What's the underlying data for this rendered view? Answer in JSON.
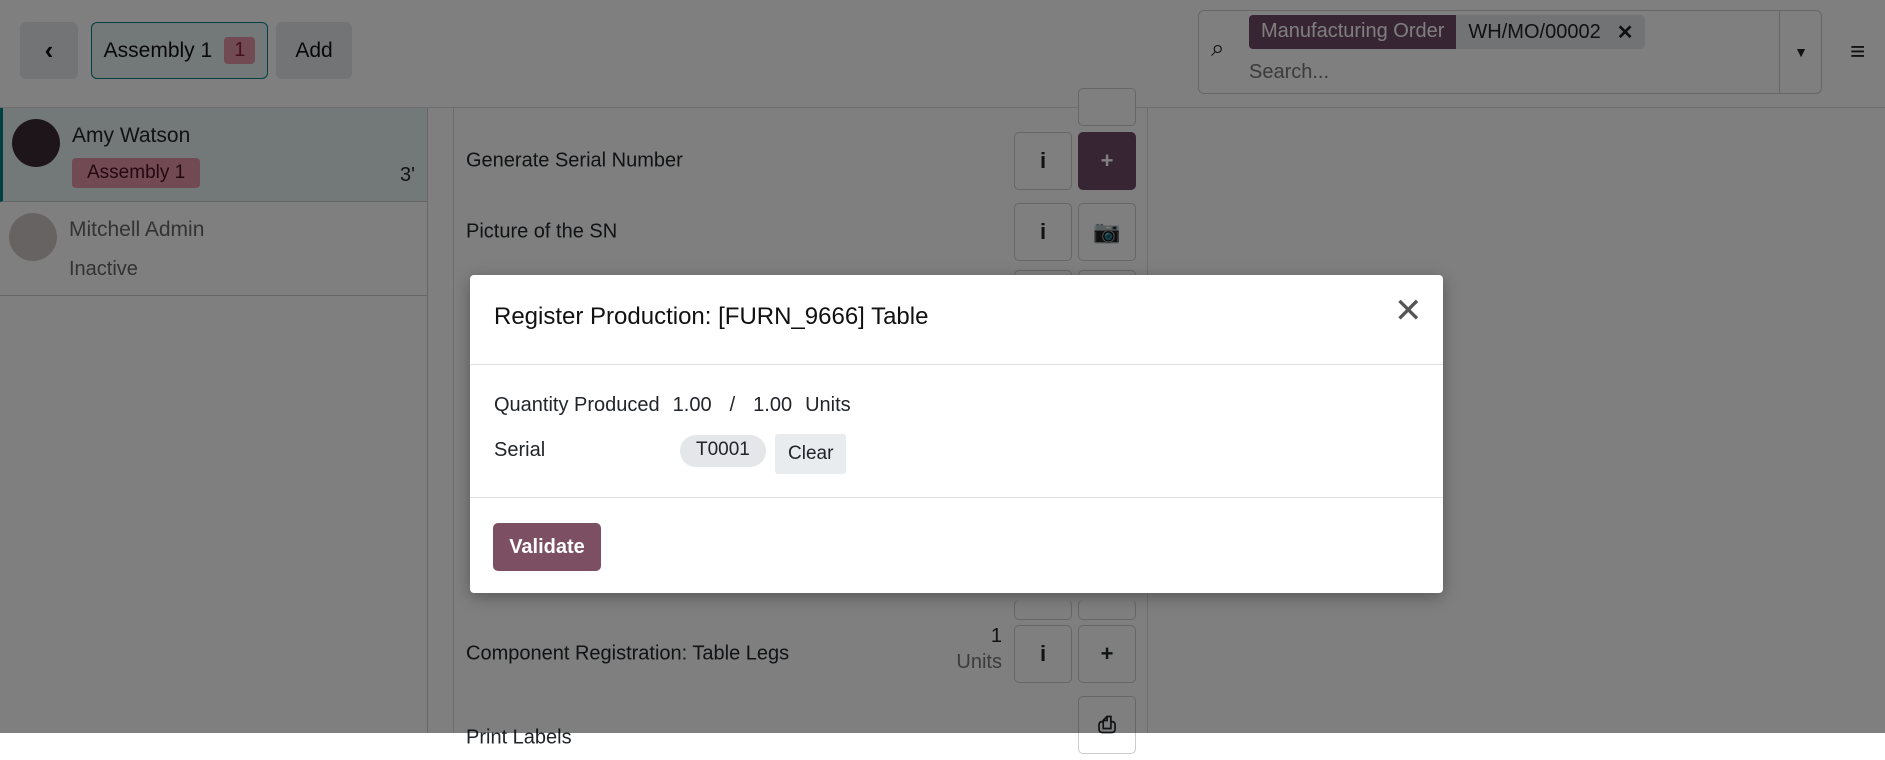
{
  "topbar": {
    "back_icon": "chevron-left-icon",
    "workcenter_label": "Assembly 1",
    "workcenter_count": "1",
    "add_label": "Add"
  },
  "search": {
    "facet_name": "Manufacturing Order",
    "facet_value": "WH/MO/00002",
    "placeholder": "Search..."
  },
  "employees": [
    {
      "name": "Amy Watson",
      "workcenter": "Assembly 1",
      "time": "3'"
    },
    {
      "name": "Mitchell Admin",
      "status": "Inactive"
    }
  ],
  "steps": [
    {
      "label": "Generate Serial Number"
    },
    {
      "label": "Picture of the SN"
    },
    {
      "label": "Component Registration: Table Legs",
      "qty": "1",
      "uom": "Units"
    },
    {
      "label": "Print Labels"
    }
  ],
  "modal": {
    "title": "Register Production: [FURN_9666] Table",
    "qty_label": "Quantity Produced",
    "qty_done": "1.00",
    "qty_sep": "/",
    "qty_total": "1.00",
    "uom": "Units",
    "serial_label": "Serial",
    "serial_value": "T0001",
    "clear_label": "Clear",
    "validate_label": "Validate"
  },
  "colors": {
    "primary": "#714b67",
    "badge": "#e394a6"
  }
}
